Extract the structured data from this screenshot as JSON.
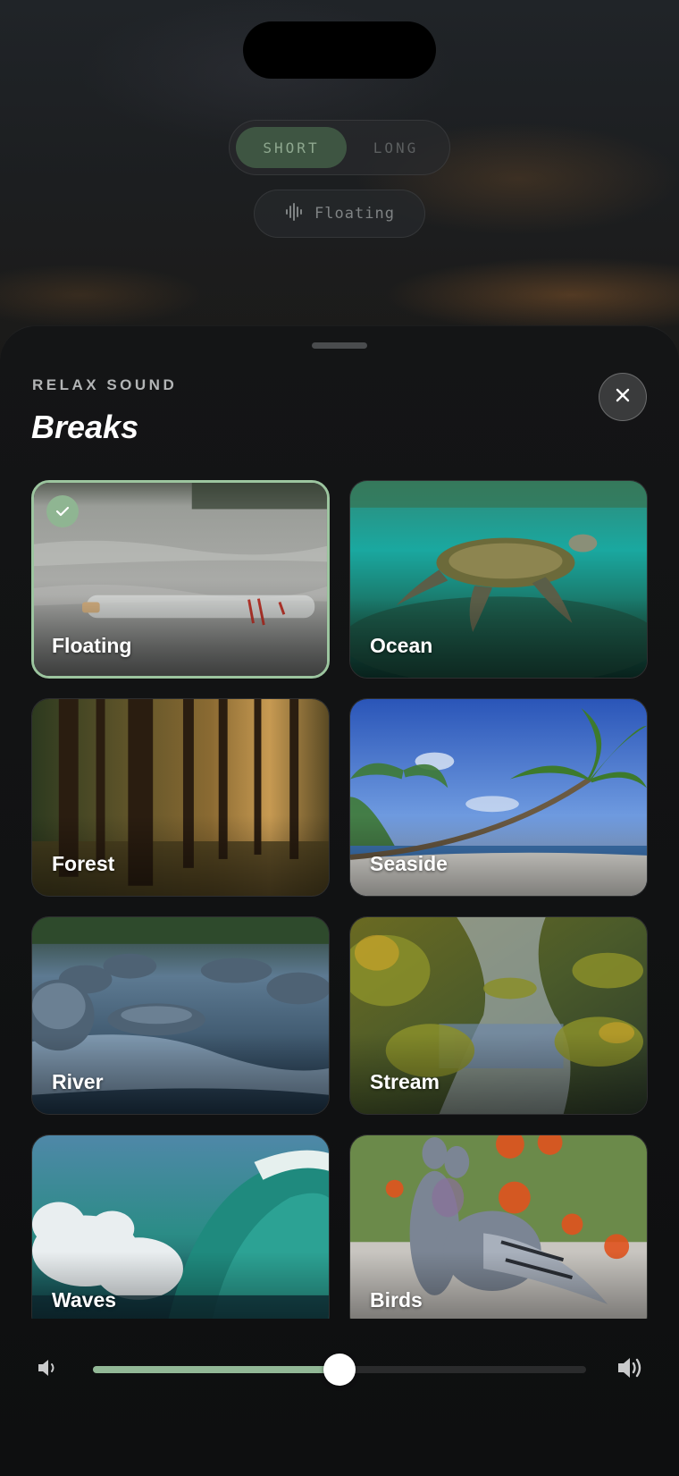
{
  "mode_toggle": {
    "short_label": "SHORT",
    "long_label": "LONG",
    "selected": "SHORT"
  },
  "current_sound": {
    "icon": "waveform-icon",
    "label": "Floating"
  },
  "sheet": {
    "eyebrow": "RELAX SOUND",
    "title": "Breaks",
    "close_icon": "close-icon"
  },
  "sounds": [
    {
      "label": "Floating",
      "selected": true
    },
    {
      "label": "Ocean",
      "selected": false
    },
    {
      "label": "Forest",
      "selected": false
    },
    {
      "label": "Seaside",
      "selected": false
    },
    {
      "label": "River",
      "selected": false
    },
    {
      "label": "Stream",
      "selected": false
    },
    {
      "label": "Waves",
      "selected": false
    },
    {
      "label": "Birds",
      "selected": false
    }
  ],
  "volume": {
    "level": 0.5,
    "low_icon": "volume-low-icon",
    "high_icon": "volume-high-icon"
  },
  "colors": {
    "accent": "#92b896",
    "selected_border": "#9cc59f"
  }
}
